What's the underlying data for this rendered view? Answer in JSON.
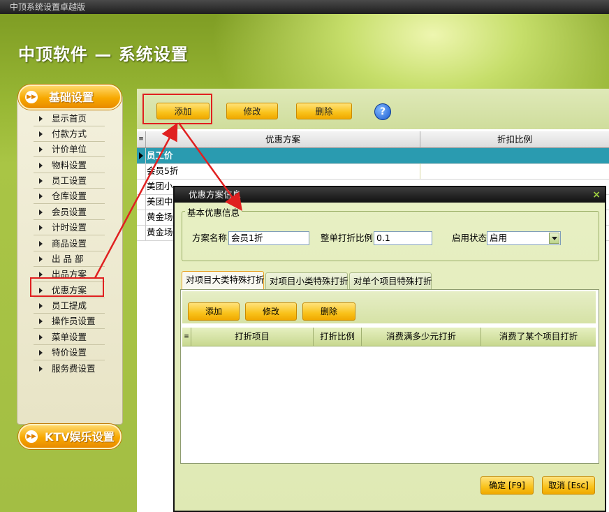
{
  "window": {
    "title": "中顶系统设置卓越版"
  },
  "app": {
    "title": "中顶软件 — 系统设置"
  },
  "sidebar": {
    "section1": "基础设置",
    "section2": "KTV娱乐设置",
    "items": [
      {
        "label": "显示首页"
      },
      {
        "label": "付款方式"
      },
      {
        "label": "计价单位"
      },
      {
        "label": "物料设置"
      },
      {
        "label": "员工设置"
      },
      {
        "label": "仓库设置"
      },
      {
        "label": "会员设置"
      },
      {
        "label": "计时设置"
      },
      {
        "label": "商品设置"
      },
      {
        "label": "出 品 部"
      },
      {
        "label": "出品方案"
      },
      {
        "label": "优惠方案"
      },
      {
        "label": "员工提成"
      },
      {
        "label": "操作员设置"
      },
      {
        "label": "菜单设置"
      },
      {
        "label": "特价设置"
      },
      {
        "label": "服务费设置"
      }
    ]
  },
  "toolbar": {
    "add": "添加",
    "edit": "修改",
    "delete": "删除",
    "help": "?"
  },
  "grid": {
    "columns": [
      "优惠方案",
      "折扣比例"
    ],
    "rows": [
      "员工价",
      "会员5折",
      "美团小",
      "美团中",
      "黄金场",
      "黄金场"
    ]
  },
  "dialog": {
    "title": "优惠方案信息",
    "close": "×",
    "group_label": "基本优惠信息",
    "name_label": "方案名称",
    "name_value": "会员1折",
    "ratio_label": "整单打折比例",
    "ratio_value": "0.1",
    "status_label": "启用状态",
    "status_value": "启用",
    "tabs": [
      "对项目大类特殊打折",
      "对项目小类特殊打折",
      "对单个项目特殊打折"
    ],
    "sub_add": "添加",
    "sub_edit": "修改",
    "sub_delete": "删除",
    "sub_columns": [
      "打折项目",
      "打折比例",
      "消费满多少元打折",
      "消费了某个项目打折"
    ],
    "ok": "确定 [F9]",
    "cancel": "取消 [Esc]"
  },
  "colors": {
    "accent": "#f7a800",
    "selection": "#2a9bb0",
    "annotation": "#e02020"
  }
}
